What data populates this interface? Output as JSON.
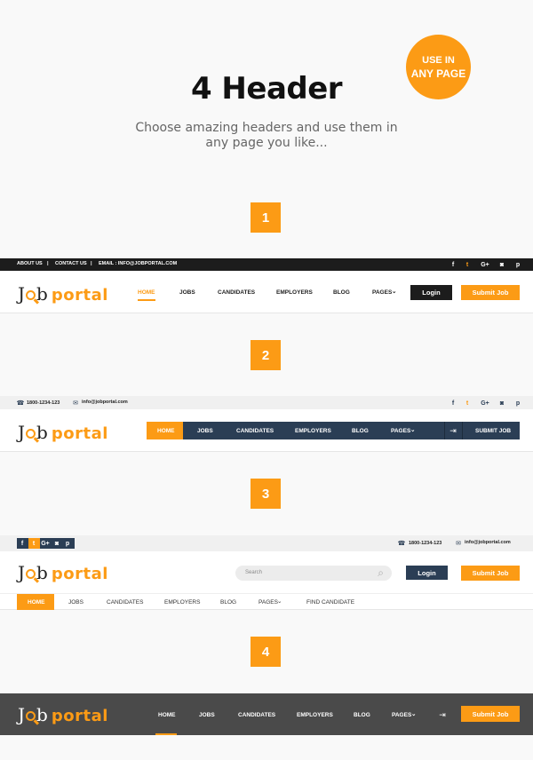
{
  "hero": {
    "title": "4 Header",
    "subtitle": "Choose amazing headers and use them in any page you like...",
    "badge_line1": "USE IN",
    "badge_line2": "ANY PAGE"
  },
  "section_numbers": [
    "1",
    "2",
    "3",
    "4"
  ],
  "logo": {
    "jo": "J",
    "b": "b",
    "portal": "portal"
  },
  "colors": {
    "accent": "#fc9b15",
    "dark": "#1c1c1c",
    "navy": "#2b3e55",
    "gray": "#4a4a4a"
  },
  "header1": {
    "top_links": [
      "ABOUT US",
      "CONTACT US",
      "EMAIL : INFO@JOBPORTAL.COM"
    ],
    "separator": "|",
    "social": [
      "facebook-icon",
      "twitter-icon",
      "google-plus-icon",
      "instagram-icon",
      "pinterest-icon"
    ],
    "nav": [
      "HOME",
      "JOBS",
      "CANDIDATES",
      "EMPLOYERS",
      "BLOG",
      "PAGES"
    ],
    "login": "Login",
    "submit": "Submit Job"
  },
  "header2": {
    "phone": "1800-1234-123",
    "email": "info@jobportal.com",
    "nav": [
      "HOME",
      "JOBS",
      "CANDIDATES",
      "EMPLOYERS",
      "BLOG",
      "PAGES"
    ],
    "submit": "SUBMIT JOB"
  },
  "header3": {
    "phone": "1800-1234-123",
    "email": "info@jobportal.com",
    "search_placeholder": "Search",
    "login": "Login",
    "submit": "Submit Job",
    "nav": [
      "HOME",
      "JOBS",
      "CANDIDATES",
      "EMPLOYERS",
      "BLOG",
      "PAGES",
      "FIND CANDIDATE"
    ]
  },
  "header4": {
    "nav": [
      "HOME",
      "JOBS",
      "CANDIDATES",
      "EMPLOYERS",
      "BLOG",
      "PAGES"
    ],
    "submit": "Submit Job"
  },
  "glyphs": {
    "chevron": "⌄",
    "facebook": "f",
    "twitter": "t",
    "gplus": "G+",
    "instagram": "◙",
    "pinterest": "p",
    "phone": "☎",
    "mail": "✉",
    "login": "⇥",
    "search": "⌕"
  }
}
